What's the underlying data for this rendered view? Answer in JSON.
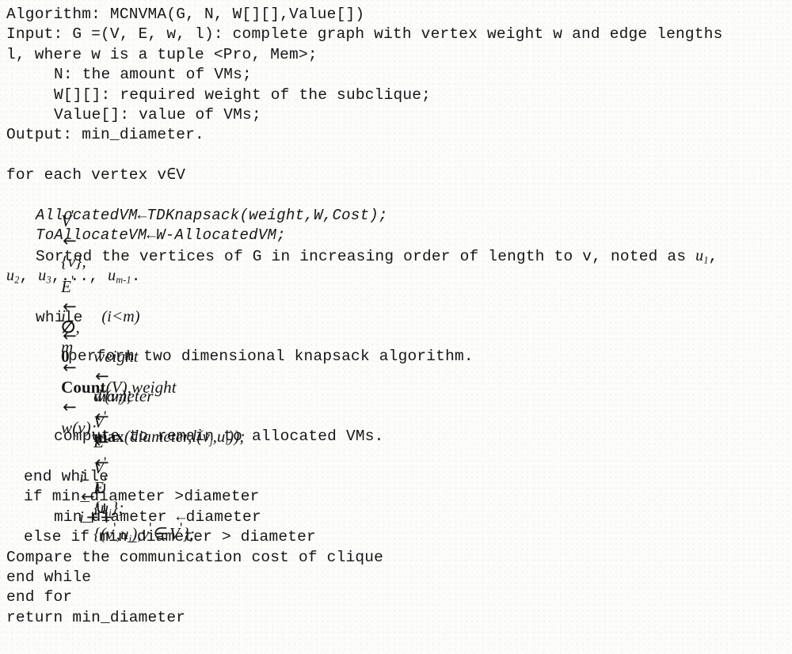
{
  "document": {
    "kind": "algorithm-pseudocode",
    "title": "Algorithm: MCNVMA(G, N, W[][],Value[])",
    "background_color": "#fcfcfa",
    "text_color": "#161616"
  },
  "header": {
    "line_algorithm": "Algorithm: MCNVMA(G, N, W[][],Value[])",
    "line_input_1": "Input: G =(V, E, w, l): complete graph with vertex weight w and edge lengths",
    "line_input_2": "l, where w is a tuple <Pro, Mem>;",
    "line_input_n": "N: the amount of VMs;",
    "line_input_w": "W[][]: required weight of the subclique;",
    "line_input_value": "Value[]: value of VMs;",
    "line_output": "Output: min_diameter."
  },
  "body": {
    "for_each_vertex": "for each vertex v∈V",
    "init_assign": {
      "v_prime": "V",
      "arrow": "←",
      "set_v": "{v}",
      "comma1": ",",
      "e_prime": "E",
      "empty_set": "∅",
      "comma2": ",",
      "m": "m",
      "count_fn": "Count",
      "count_arg": "(V)",
      "comma3": ",",
      "weight": "weight",
      "w_of_v": "w(v)",
      "semicolon": ";"
    },
    "allocated_vm": "AllocatedVM←TDKnapsack(weight,W,Cost);",
    "to_allocate_vm": "ToAllocateVM←W-AllocatedVM;",
    "sorted_line_1": "Sorted the vertices of G in increasing order of length to v, noted as ",
    "sorted_u1_base": "u",
    "sorted_u1_sub": "1",
    "sorted_u1_tail": ",",
    "sorted_line_2_u2": "u",
    "sorted_line_2_u2_sub": "2",
    "sorted_line_2_sep1": ", ",
    "sorted_line_2_u3": "u",
    "sorted_line_2_u3_sub": "3",
    "sorted_line_2_sep2": ",..., ",
    "sorted_line_2_um": "u",
    "sorted_line_2_um_sub": "m-1",
    "sorted_line_2_end": ".",
    "i_init": {
      "i": "i",
      "arrow": "←",
      "zero": "0"
    },
    "while_cond": {
      "kw": "while",
      "open": "(",
      "i": "i",
      "lt": "<",
      "m": "m",
      "close": ")"
    },
    "weight_assign": {
      "weight": "weight",
      "arrow": "←",
      "w": "w",
      "open": "(",
      "v": "v",
      "sub": "i",
      "close": ")",
      "semi": ";"
    },
    "perform_knapsack": "perform two dimensional knapsack algorithm.",
    "diameter_assign": {
      "diameter": "diameter",
      "arrow": "←",
      "max_fn": "max",
      "open": "(",
      "arg1": "diameter",
      "comma": ",",
      "l": "l",
      "open2": "(",
      "v": "v",
      "v_sub": "j",
      "comma2": ",",
      "u": "u",
      "u_sub": "i",
      "close2": ")",
      "close": ")",
      "semi": ";"
    },
    "v_union": {
      "v_prime": "V",
      "arrow": "←",
      "v_prime2": "V",
      "union": "∪",
      "open": "{",
      "u": "u",
      "u_sub": "i",
      "close": "}",
      "semi": ";"
    },
    "e_union": {
      "e_prime": "E",
      "arrow": "←",
      "e_prime2": "E",
      "union": "∪",
      "open_brace": "{",
      "open_paren": "(",
      "v_prime": "v",
      "comma": ",",
      "u": "u",
      "u_sub": "i",
      "close_paren": ")",
      "comma2": ",",
      "v_prime2": "v",
      "in": "∈",
      "V_prime": "V",
      "close_brace": "}",
      "semi": ";"
    },
    "compute_remain": "compute to remain to allocated VMs.",
    "i_increment": {
      "i": "i",
      "arrow": "←",
      "i2": "i",
      "plusplus": "++"
    },
    "end_while_inner": "end while",
    "if_min_diameter": "if min_diameter >diameter",
    "assign_min_diameter": "min_diameter ←diameter",
    "else_if_min_diameter": "else if min_diameter > diameter",
    "compare_cost": "Compare the communication cost of clique",
    "end_while_outer": "end while",
    "end_for": "end for",
    "return_stmt": "return min_diameter"
  }
}
